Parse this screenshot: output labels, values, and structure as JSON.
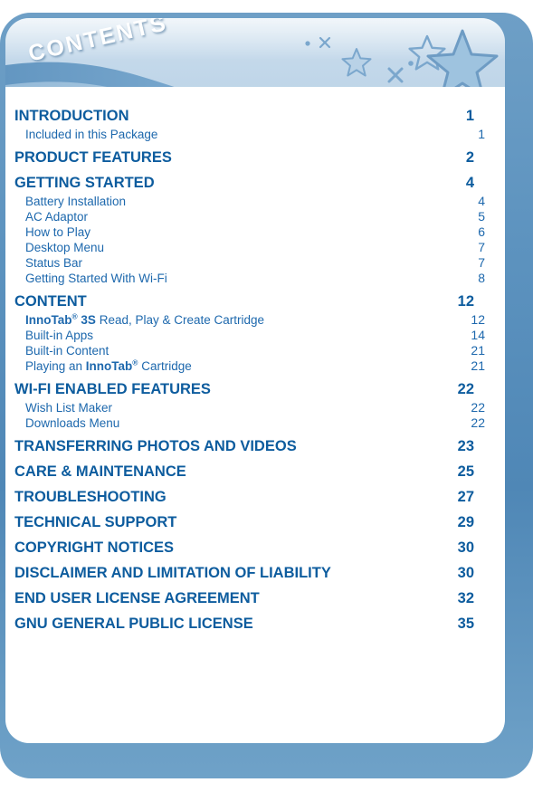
{
  "document": {
    "header_title": "CONTENTS",
    "colors": {
      "frame_blue": "#5d93bf",
      "header_light": "#c7dbec",
      "heading_blue": "#0d5c9e",
      "sub_blue": "#1d68ad",
      "leader_dot": "#2a6fae"
    }
  },
  "toc": {
    "entries": [
      {
        "level": "major",
        "label": "INTRODUCTION",
        "page": "1"
      },
      {
        "level": "sub",
        "label": "Included in this Package",
        "page": "1"
      },
      {
        "level": "major",
        "label": "PRODUCT FEATURES",
        "page": "2"
      },
      {
        "level": "major",
        "label": "GETTING STARTED",
        "page": "4"
      },
      {
        "level": "sub",
        "label": "Battery Installation",
        "page": "4"
      },
      {
        "level": "sub",
        "label": "AC Adaptor",
        "page": "5"
      },
      {
        "level": "sub",
        "label": "How to Play",
        "page": "6"
      },
      {
        "level": "sub",
        "label": "Desktop Menu",
        "page": "7"
      },
      {
        "level": "sub",
        "label": "Status Bar",
        "page": "7"
      },
      {
        "level": "sub",
        "label": "Getting Started With Wi-Fi",
        "page": "8"
      },
      {
        "level": "major",
        "label": "CONTENT",
        "page": "12"
      },
      {
        "level": "sub",
        "label": "InnoTab® 3S Read, Play & Create Cartridge",
        "bold_prefix": "InnoTab® 3S",
        "rest": " Read, Play & Create Cartridge",
        "page": "12"
      },
      {
        "level": "sub",
        "label": "Built-in Apps",
        "page": "14"
      },
      {
        "level": "sub",
        "label": "Built-in Content",
        "page": "21"
      },
      {
        "level": "sub",
        "label": "Playing an InnoTab® Cartridge",
        "prefix": "Playing an ",
        "bold_mid": "InnoTab®",
        "rest": " Cartridge",
        "page": "21"
      },
      {
        "level": "major",
        "label": "WI-FI ENABLED FEATURES",
        "page": "22"
      },
      {
        "level": "sub",
        "label": "Wish List Maker",
        "page": "22"
      },
      {
        "level": "sub",
        "label": "Downloads Menu",
        "page": "22"
      },
      {
        "level": "major",
        "label": "TRANSFERRING PHOTOS AND VIDEOS",
        "page": "23"
      },
      {
        "level": "major",
        "label": "CARE & MAINTENANCE",
        "page": "25"
      },
      {
        "level": "major",
        "label": "TROUBLESHOOTING",
        "page": "27"
      },
      {
        "level": "major",
        "label": "TECHNICAL SUPPORT",
        "page": "29"
      },
      {
        "level": "major",
        "label": "COPYRIGHT NOTICES",
        "page": "30"
      },
      {
        "level": "major",
        "label": "DISCLAIMER AND LIMITATION OF LIABILITY",
        "page": "30"
      },
      {
        "level": "major",
        "label": "END USER LICENSE AGREEMENT",
        "page": "32"
      },
      {
        "level": "major",
        "label": "GNU GENERAL PUBLIC LICENSE",
        "page": "35"
      }
    ]
  },
  "decorations": {
    "star_large": "star-icon",
    "star_outline_1": "star-outline-icon",
    "star_outline_2": "star-outline-icon",
    "sparkle_x_1": "sparkle-x-icon",
    "sparkle_x_2": "sparkle-x-icon",
    "sparkle_x_3": "sparkle-x-icon",
    "dots": "dot-icon"
  }
}
